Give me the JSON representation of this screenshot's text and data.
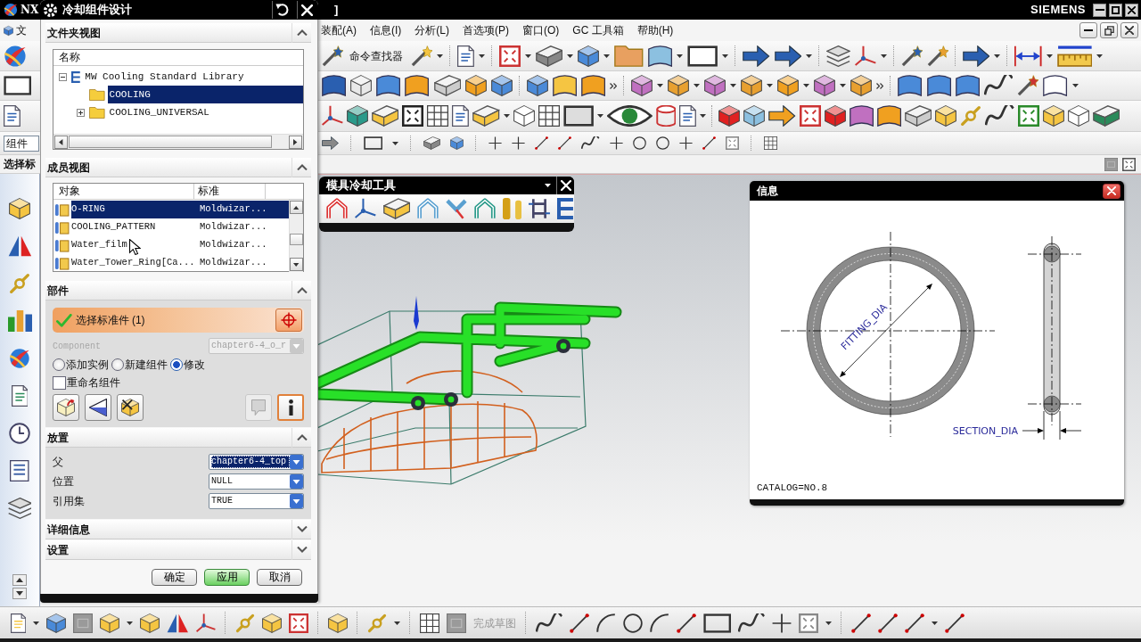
{
  "app": {
    "logo_text": "NX",
    "title_tail": "]",
    "brand": "SIEMENS"
  },
  "menu": {
    "cut_item": "文",
    "items": [
      "装配(A)",
      "信息(I)",
      "分析(L)",
      "首选项(P)",
      "窗口(O)",
      "GC 工具箱",
      "帮助(H)"
    ]
  },
  "toolbar": {
    "command_finder": "命令查找器"
  },
  "left_panel": {
    "filter": "组件",
    "selection_label": "选择标"
  },
  "dialog": {
    "title": "冷却组件设计",
    "sections": [
      {
        "kind": "tree",
        "title": "文件夹视图",
        "expanded": true,
        "column": "名称",
        "tree": [
          {
            "label": "MW Cooling Standard Library",
            "selected": false,
            "expanded": true,
            "children": [
              {
                "label": "COOLING",
                "selected": true
              },
              {
                "label": "COOLING_UNIVERSAL",
                "selected": false,
                "expanded": false
              }
            ]
          }
        ]
      },
      {
        "kind": "list",
        "title": "成员视图",
        "expanded": true,
        "columns": [
          "对象",
          "标准"
        ],
        "rows": [
          {
            "cells": [
              "O-RING",
              "Moldwizar..."
            ],
            "selected": true
          },
          {
            "cells": [
              "COOLING_PATTERN",
              "Moldwizar..."
            ],
            "selected": false
          },
          {
            "cells": [
              "Water_film",
              "Moldwizar..."
            ],
            "selected": false
          },
          {
            "cells": [
              "Water_Tower_Ring[Ca...",
              "Moldwizar..."
            ],
            "selected": false
          }
        ]
      },
      {
        "kind": "part",
        "title": "部件",
        "expanded": true,
        "step": {
          "label": "选择标准件 (1)",
          "done": true
        },
        "component": {
          "label": "Component",
          "value": "chapter6-4_o_r",
          "disabled": true
        },
        "modes": [
          {
            "label": "添加实例",
            "selected": false
          },
          {
            "label": "新建组件",
            "selected": false
          },
          {
            "label": "修改",
            "selected": true
          }
        ],
        "rename": {
          "label": "重命名组件",
          "checked": false
        }
      },
      {
        "kind": "placement",
        "title": "放置",
        "expanded": true,
        "fields": [
          {
            "label": "父",
            "value": "chapter6-4_top",
            "selected": true
          },
          {
            "label": "位置",
            "value": "NULL",
            "selected": false
          },
          {
            "label": "引用集",
            "value": "TRUE",
            "selected": false
          }
        ]
      },
      {
        "title": "详细信息",
        "expanded": false
      },
      {
        "title": "设置",
        "expanded": false
      }
    ],
    "buttons": [
      {
        "label": "确定",
        "kind": "default"
      },
      {
        "label": "应用",
        "kind": "primary"
      },
      {
        "label": "取消",
        "kind": "default"
      }
    ]
  },
  "cooling_toolbar": {
    "title": "模具冷却工具"
  },
  "info_window": {
    "title": "信息",
    "fitting_label": "FITTING_DIA",
    "section_label": "SECTION_DIA",
    "catalog": "CATALOG=NO.8"
  },
  "bottom_toolbar": {
    "finish_sketch": {
      "label": "完成草图",
      "disabled": true
    }
  }
}
